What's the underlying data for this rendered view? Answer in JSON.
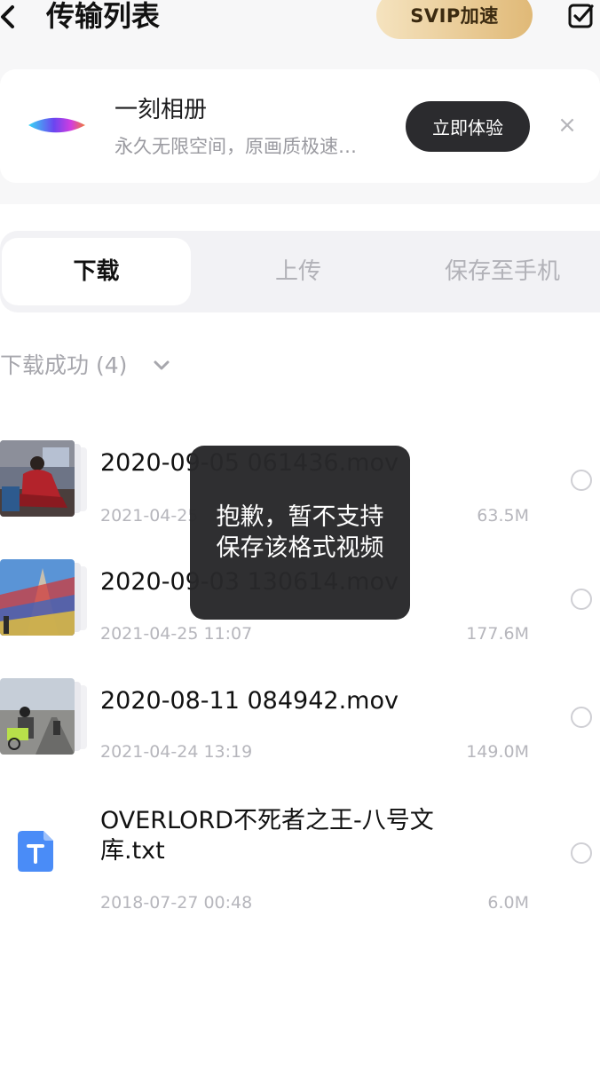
{
  "header": {
    "title": "传输列表",
    "svip_label": "SVIP加速"
  },
  "promo": {
    "title": "一刻相册",
    "subtitle": "永久无限空间，原画质极速…",
    "button": "立即体验",
    "close": "×"
  },
  "tabs": [
    {
      "label": "下载",
      "active": true
    },
    {
      "label": "上传",
      "active": false
    },
    {
      "label": "保存至手机",
      "active": false
    }
  ],
  "section": {
    "title": "下载成功 (4)"
  },
  "files": [
    {
      "name": "2020-09-05 061436.mov",
      "date": "2021-04-25",
      "size": "63.5M",
      "thumb": "person-in-red-jacket"
    },
    {
      "name": "2020-09-03 130614.mov",
      "date": "2021-04-25 11:07",
      "size": "177.6M",
      "thumb": "prayer-flags"
    },
    {
      "name": "2020-08-11 084942.mov",
      "date": "2021-04-24 13:19",
      "size": "149.0M",
      "thumb": "cyclists-road"
    },
    {
      "name": "OVERLORD不死者之王-八号文库.txt",
      "date": "2018-07-27 00:48",
      "size": "6.0M",
      "thumb": "txt-file-icon"
    }
  ],
  "toast": {
    "line1": "抱歉，暂不支持",
    "line2": "保存该格式视频"
  },
  "colors": {
    "svip_gradient_start": "#f5e3bf",
    "svip_gradient_end": "#e0b977",
    "dark_button": "#2b2b2e",
    "txt_icon": "#4a8cf7"
  }
}
